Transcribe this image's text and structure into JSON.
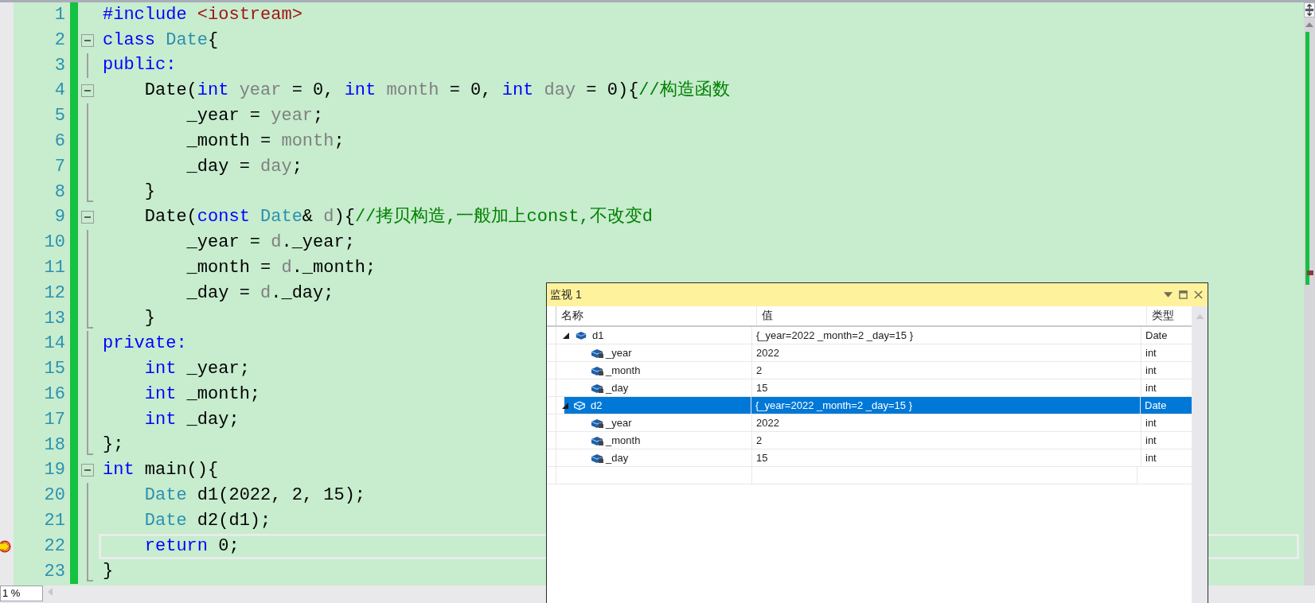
{
  "editor": {
    "lines": [
      {
        "number": "1",
        "kind": "plain",
        "current": false,
        "tokens": [
          {
            "text": "#include",
            "kind": "pp"
          },
          {
            "text": " <iostream>",
            "kind": "str"
          }
        ]
      },
      {
        "number": "2",
        "kind": "collapse",
        "current": false,
        "tokens": [
          {
            "text": "class",
            "kind": "kw"
          },
          {
            "text": " Date",
            "kind": "type"
          },
          {
            "text": "{",
            "kind": "plain"
          }
        ]
      },
      {
        "number": "3",
        "kind": "guide",
        "current": false,
        "tokens": [
          {
            "text": "public:",
            "kind": "kw"
          }
        ]
      },
      {
        "number": "4",
        "kind": "collapse",
        "current": false,
        "tokens": [
          {
            "text": "    Date(",
            "kind": "plain"
          },
          {
            "text": "int",
            "kind": "kw"
          },
          {
            "text": " year",
            "kind": "param"
          },
          {
            "text": " = 0, ",
            "kind": "plain"
          },
          {
            "text": "int",
            "kind": "kw"
          },
          {
            "text": " month",
            "kind": "param"
          },
          {
            "text": " = 0, ",
            "kind": "plain"
          },
          {
            "text": "int",
            "kind": "kw"
          },
          {
            "text": " day",
            "kind": "param"
          },
          {
            "text": " = 0){",
            "kind": "plain"
          },
          {
            "text": "//构造函数",
            "kind": "cmt"
          }
        ]
      },
      {
        "number": "5",
        "kind": "guide",
        "current": false,
        "tokens": [
          {
            "text": "        _year = ",
            "kind": "plain"
          },
          {
            "text": "year",
            "kind": "param"
          },
          {
            "text": ";",
            "kind": "plain"
          }
        ]
      },
      {
        "number": "6",
        "kind": "guide",
        "current": false,
        "tokens": [
          {
            "text": "        _month = ",
            "kind": "plain"
          },
          {
            "text": "month",
            "kind": "param"
          },
          {
            "text": ";",
            "kind": "plain"
          }
        ]
      },
      {
        "number": "7",
        "kind": "guide",
        "current": false,
        "tokens": [
          {
            "text": "        _day = ",
            "kind": "plain"
          },
          {
            "text": "day",
            "kind": "param"
          },
          {
            "text": ";",
            "kind": "plain"
          }
        ]
      },
      {
        "number": "8",
        "kind": "end",
        "current": false,
        "tokens": [
          {
            "text": "    }",
            "kind": "plain"
          }
        ]
      },
      {
        "number": "9",
        "kind": "collapse",
        "current": false,
        "tokens": [
          {
            "text": "    Date(",
            "kind": "plain"
          },
          {
            "text": "const",
            "kind": "kw"
          },
          {
            "text": " Date",
            "kind": "type"
          },
          {
            "text": "& ",
            "kind": "plain"
          },
          {
            "text": "d",
            "kind": "param"
          },
          {
            "text": "){",
            "kind": "plain"
          },
          {
            "text": "//拷贝构造,一般加上const,不改变d",
            "kind": "cmt"
          }
        ]
      },
      {
        "number": "10",
        "kind": "guide",
        "current": false,
        "tokens": [
          {
            "text": "        _year = ",
            "kind": "plain"
          },
          {
            "text": "d",
            "kind": "param"
          },
          {
            "text": "._year;",
            "kind": "plain"
          }
        ]
      },
      {
        "number": "11",
        "kind": "guide",
        "current": false,
        "tokens": [
          {
            "text": "        _month = ",
            "kind": "plain"
          },
          {
            "text": "d",
            "kind": "param"
          },
          {
            "text": "._month;",
            "kind": "plain"
          }
        ]
      },
      {
        "number": "12",
        "kind": "guide",
        "current": false,
        "tokens": [
          {
            "text": "        _day = ",
            "kind": "plain"
          },
          {
            "text": "d",
            "kind": "param"
          },
          {
            "text": "._day;",
            "kind": "plain"
          }
        ]
      },
      {
        "number": "13",
        "kind": "end",
        "current": false,
        "tokens": [
          {
            "text": "    }",
            "kind": "plain"
          }
        ]
      },
      {
        "number": "14",
        "kind": "guide",
        "current": false,
        "tokens": [
          {
            "text": "private:",
            "kind": "kw"
          }
        ]
      },
      {
        "number": "15",
        "kind": "guide",
        "current": false,
        "tokens": [
          {
            "text": "    int",
            "kind": "kw"
          },
          {
            "text": " _year;",
            "kind": "plain"
          }
        ]
      },
      {
        "number": "16",
        "kind": "guide",
        "current": false,
        "tokens": [
          {
            "text": "    int",
            "kind": "kw"
          },
          {
            "text": " _month;",
            "kind": "plain"
          }
        ]
      },
      {
        "number": "17",
        "kind": "guide",
        "current": false,
        "tokens": [
          {
            "text": "    int",
            "kind": "kw"
          },
          {
            "text": " _day;",
            "kind": "plain"
          }
        ]
      },
      {
        "number": "18",
        "kind": "end",
        "current": false,
        "tokens": [
          {
            "text": "};",
            "kind": "plain"
          }
        ]
      },
      {
        "number": "19",
        "kind": "collapse",
        "current": false,
        "tokens": [
          {
            "text": "int",
            "kind": "kw"
          },
          {
            "text": " main(){",
            "kind": "plain"
          }
        ]
      },
      {
        "number": "20",
        "kind": "guide",
        "current": false,
        "tokens": [
          {
            "text": "    Date",
            "kind": "type"
          },
          {
            "text": " d1(2022, 2, 15);",
            "kind": "plain"
          }
        ]
      },
      {
        "number": "21",
        "kind": "guide",
        "current": false,
        "tokens": [
          {
            "text": "    Date",
            "kind": "type"
          },
          {
            "text": " d2(d1);",
            "kind": "plain"
          }
        ]
      },
      {
        "number": "22",
        "kind": "guide",
        "current": true,
        "tokens": [
          {
            "text": "    return",
            "kind": "kw"
          },
          {
            "text": " 0;",
            "kind": "plain"
          }
        ]
      },
      {
        "number": "23",
        "kind": "end",
        "current": false,
        "tokens": [
          {
            "text": "}",
            "kind": "plain"
          }
        ]
      }
    ]
  },
  "zoom_level": "1 %",
  "watch": {
    "title": "监视 1",
    "columns": [
      "名称",
      "值",
      "类型"
    ],
    "rows": [
      {
        "name": "d1",
        "value": "{_year=2022 _month=2 _day=15 }",
        "type": "Date",
        "expanded": true,
        "selected": false,
        "children": [
          {
            "name": "_year",
            "value": "2022",
            "type": "int"
          },
          {
            "name": "_month",
            "value": "2",
            "type": "int"
          },
          {
            "name": "_day",
            "value": "15",
            "type": "int"
          }
        ]
      },
      {
        "name": "d2",
        "value": "{_year=2022 _month=2 _day=15 }",
        "type": "Date",
        "expanded": true,
        "selected": true,
        "children": [
          {
            "name": "_year",
            "value": "2022",
            "type": "int"
          },
          {
            "name": "_month",
            "value": "2",
            "type": "int"
          },
          {
            "name": "_day",
            "value": "15",
            "type": "int"
          }
        ]
      }
    ]
  }
}
